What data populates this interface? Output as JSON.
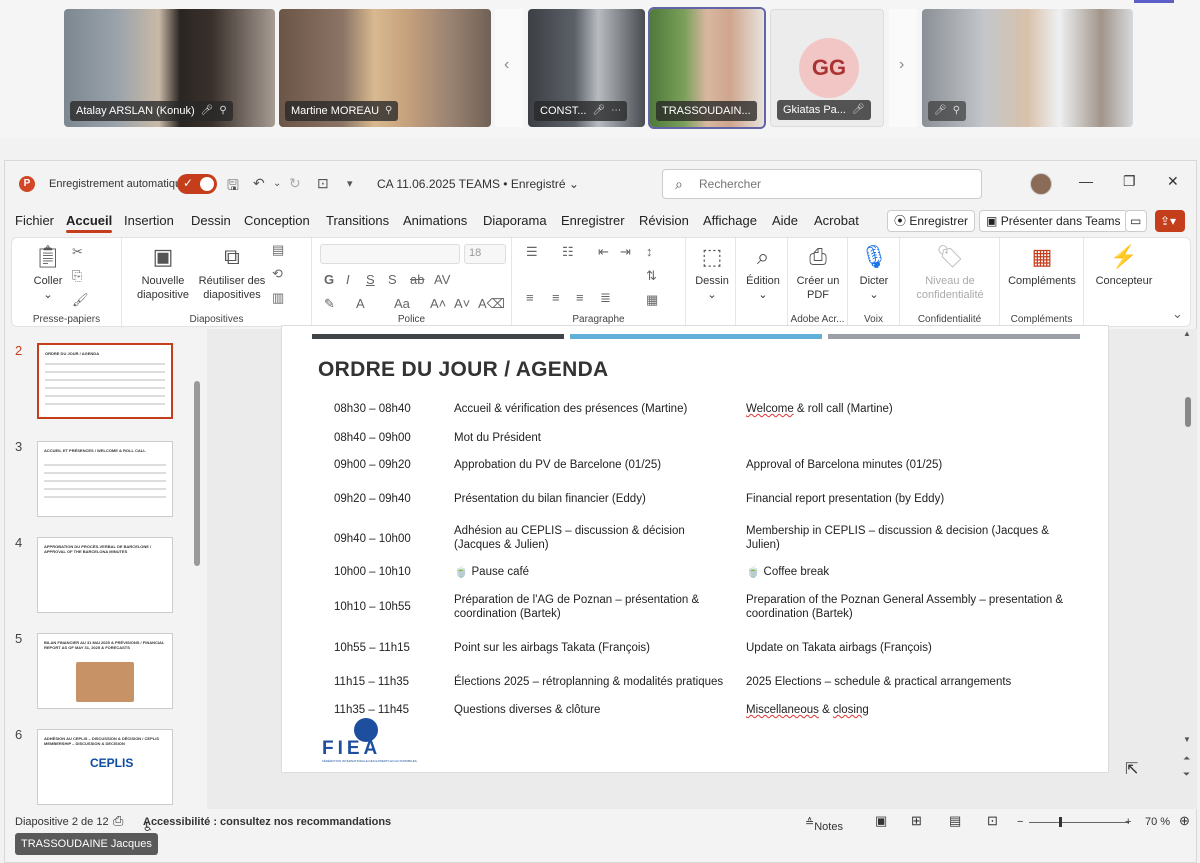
{
  "participants": [
    {
      "name": "Atalay ARSLAN (Konuk)"
    },
    {
      "name": "Martine MOREAU"
    },
    {
      "name": "CONST..."
    },
    {
      "name": "TRASSOUDAIN..."
    },
    {
      "name": "Gkiatas Pa...",
      "initials": "GG"
    }
  ],
  "window": {
    "autosave_label": "Enregistrement automatique",
    "doc_title": "CA 11.06.2025 TEAMS • Enregistré",
    "search_placeholder": "Rechercher"
  },
  "menu": {
    "items": [
      "Fichier",
      "Accueil",
      "Insertion",
      "Dessin",
      "Conception",
      "Transitions",
      "Animations",
      "Diaporama",
      "Enregistrer",
      "Révision",
      "Affichage",
      "Aide",
      "Acrobat"
    ],
    "active": "Accueil",
    "record_button": "Enregistrer",
    "present_teams_button": "Présenter dans Teams"
  },
  "ribbon": {
    "paste": "Coller",
    "clipboard_group": "Presse-papiers",
    "new_slide": "Nouvelle diapositive",
    "reuse_slides": "Réutiliser des diapositives",
    "slides_group": "Diapositives",
    "font_size": "18",
    "font_group": "Police",
    "paragraph_group": "Paragraphe",
    "draw": "Dessin",
    "edit": "Édition",
    "create_pdf": "Créer un PDF",
    "adobe_group": "Adobe Acr...",
    "dictate": "Dicter",
    "voice_group": "Voix",
    "sensitivity": "Niveau de confidentialité",
    "confidentiality_group": "Confidentialité",
    "addins": "Compléments",
    "addins_group": "Compléments",
    "designer": "Concepteur"
  },
  "thumbnails": [
    {
      "num": "2",
      "title": "ORDRE DU JOUR / AGENDA"
    },
    {
      "num": "3",
      "title": "ACCUEIL ET PRÉSENCES / WELCOME & ROLL CALL"
    },
    {
      "num": "4",
      "title": "APPROBATION DU PROCÈS-VERBAL DE BARCELONE / APPROVAL OF THE BARCELONA MINUTES"
    },
    {
      "num": "5",
      "title": "BILAN FINANCIER AU 31 MAI 2025 & PRÉVISIONS / FINANCIAL REPORT AS OF MAY 31, 2025 & FORECASTS"
    },
    {
      "num": "6",
      "title": "ADHÉSION AU CEPLIS – DISCUSSION & DÉCISION / CEPLIS MEMBERSHIP – DISCUSSION & DECISION",
      "logo": "CEPLIS"
    }
  ],
  "slide": {
    "title": "ORDRE DU JOUR / AGENDA",
    "stripe_colors": [
      "#3f4448",
      "#62b0d9",
      "#9aa0a6"
    ],
    "logo_text": "FIEA",
    "logo_subtitle": "FÉDÉRATION INTERNATIONALE DES EXPERTS EN AUTOMOBILES",
    "rows": [
      {
        "time": "08h30 – 08h40",
        "fr": "Accueil & vérification des présences (Martine)",
        "en_pre": "",
        "en_flag": "Welcome",
        "en_post": " & roll call (Martine)"
      },
      {
        "time": "08h40 – 09h00",
        "fr": "Mot du Président",
        "en_pre": "",
        "en_flag": "",
        "en_post": ""
      },
      {
        "time": "09h00 – 09h20",
        "fr": "Approbation du PV de Barcelone (01/25)",
        "en_pre": "Approval of Barcelona minutes (01/25)",
        "en_flag": "",
        "en_post": ""
      },
      {
        "time": "09h20 – 09h40",
        "fr": "Présentation du bilan financier (Eddy)",
        "en_pre": "Financial report presentation (by Eddy)",
        "en_flag": "",
        "en_post": ""
      },
      {
        "time": "09h40 – 10h00",
        "fr": "Adhésion au CEPLIS – discussion & décision (Jacques & Julien)",
        "en_pre": "Membership in CEPLIS – discussion & decision (Jacques & Julien)",
        "en_flag": "",
        "en_post": ""
      },
      {
        "time": "10h00 – 10h10",
        "fr": "🍵 Pause café",
        "en_pre": "🍵 Coffee break",
        "en_flag": "",
        "en_post": ""
      },
      {
        "time": "10h10 – 10h55",
        "fr": "Préparation de l'AG de Poznan – présentation & coordination (Bartek)",
        "en_pre": "Preparation of the Poznan General Assembly – presentation & coordination (Bartek)",
        "en_flag": "",
        "en_post": ""
      },
      {
        "time": "10h55 – 11h15",
        "fr": "Point sur les airbags Takata (François)",
        "en_pre": "Update on Takata airbags (François)",
        "en_flag": "",
        "en_post": ""
      },
      {
        "time": "11h15 – 11h35",
        "fr": "Élections 2025 – rétroplanning & modalités pratiques",
        "en_pre": "2025 Elections – schedule & practical arrangements",
        "en_flag": "",
        "en_post": ""
      },
      {
        "time": "11h35 – 11h45",
        "fr": "Questions diverses & clôture",
        "en_pre": "",
        "en_flag": "Miscellaneous",
        "en_post": " & ",
        "en_flag2": "closing"
      }
    ]
  },
  "status": {
    "slide_counter": "Diapositive 2 de 12",
    "accessibility": "Accessibilité : consultez nos recommandations",
    "notes": "Notes",
    "zoom": "70 %",
    "presenter_name": "TRASSOUDAINE Jacques"
  }
}
